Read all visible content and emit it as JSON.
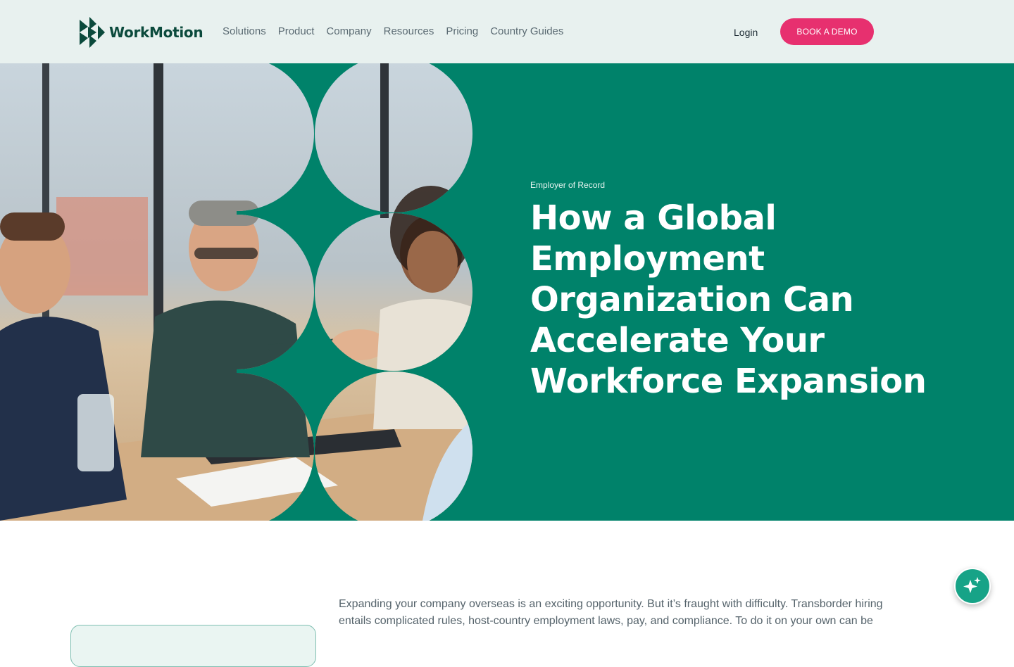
{
  "brand": {
    "name": "WorkMotion",
    "color": "#0b4a3c"
  },
  "nav": {
    "items": [
      {
        "label": "Solutions"
      },
      {
        "label": "Product"
      },
      {
        "label": "Company"
      },
      {
        "label": "Resources"
      },
      {
        "label": "Pricing"
      },
      {
        "label": "Country Guides"
      }
    ],
    "login_label": "Login",
    "demo_label": "BOOK A DEMO"
  },
  "hero": {
    "eyebrow": "Employer of Record",
    "title": "How a Global Employment Organization Can Accelerate Your Workforce Expansion",
    "image": "business-handshake-meeting-photo",
    "background_color": "#00826a"
  },
  "article": {
    "intro": "Expanding your company overseas is an exciting opportunity. But it’s fraught with difficulty. Transborder hiring entails complicated rules, host-country employment laws, pay, and compliance. To do it on your own can be"
  },
  "colors": {
    "accent": "#e7306f",
    "hero": "#00826a",
    "header_bg": "#e8f1ef"
  },
  "assistant": {
    "icon": "sparkle-icon"
  }
}
